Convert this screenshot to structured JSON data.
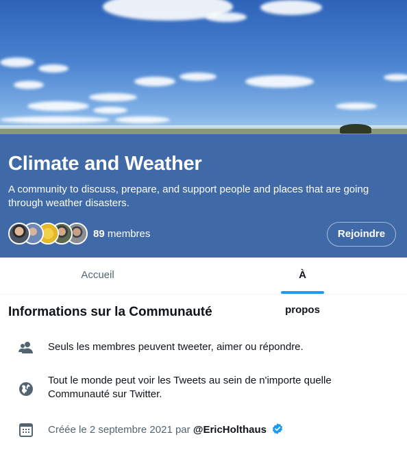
{
  "community": {
    "title": "Climate and Weather",
    "description": "A community to discuss, prepare, and support people and places that are going through weather disasters.",
    "member_count": "89",
    "members_label": "membres",
    "join_label": "Rejoindre"
  },
  "tabs": [
    {
      "label": "Accueil",
      "active": false
    },
    {
      "label": "À propos",
      "active": true
    }
  ],
  "about": {
    "title": "Informations sur la Communauté",
    "rules": [
      {
        "icon": "people-icon",
        "text": "Seuls les membres peuvent tweeter, aimer ou répondre."
      },
      {
        "icon": "globe-icon",
        "text": "Tout le monde peut voir les Tweets au sein de n'importe quelle Communauté sur Twitter."
      },
      {
        "icon": "calendar-icon",
        "prefix": "Créée le 2 septembre 2021 par",
        "handle": "@EricHolthaus",
        "badge": "verified-badge-icon"
      }
    ]
  },
  "colors": {
    "panel": "#4069a8",
    "accent": "#1d9bf0",
    "muted": "#536471"
  }
}
